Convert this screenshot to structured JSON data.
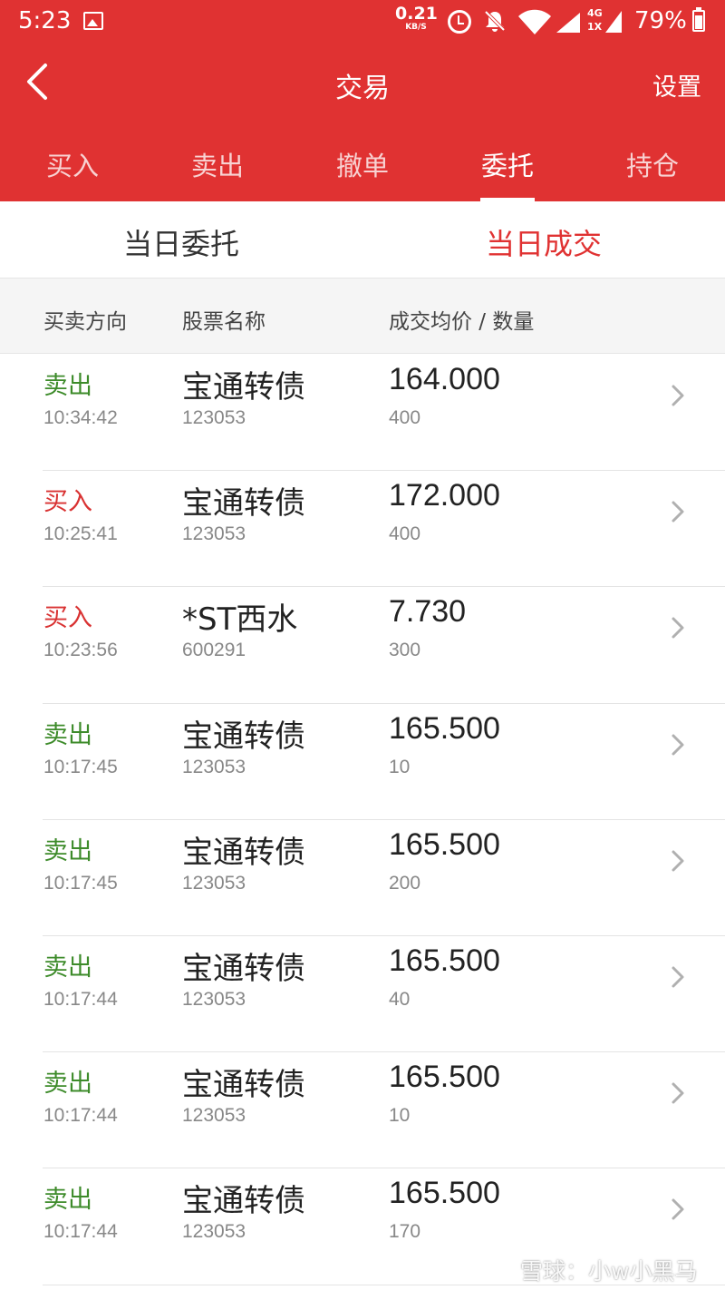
{
  "status_bar": {
    "time": "5:23",
    "net_speed": "0.21",
    "net_speed_unit": "KB/S",
    "network_badge_top": "4G",
    "network_badge_bottom": "1X",
    "battery": "79%"
  },
  "header": {
    "title": "交易",
    "settings_label": "设置"
  },
  "tabs": [
    {
      "label": "买入",
      "active": false
    },
    {
      "label": "卖出",
      "active": false
    },
    {
      "label": "撤单",
      "active": false
    },
    {
      "label": "委托",
      "active": true
    },
    {
      "label": "持仓",
      "active": false
    }
  ],
  "subtabs": [
    {
      "label": "当日委托",
      "active": false
    },
    {
      "label": "当日成交",
      "active": true
    }
  ],
  "columns": {
    "direction": "买卖方向",
    "stock_name": "股票名称",
    "price_qty": "成交均价 / 数量"
  },
  "rows": [
    {
      "direction": "卖出",
      "type": "sell",
      "time": "10:34:42",
      "name": "宝通转债",
      "code": "123053",
      "price": "164.000",
      "qty": "400"
    },
    {
      "direction": "买入",
      "type": "buy",
      "time": "10:25:41",
      "name": "宝通转债",
      "code": "123053",
      "price": "172.000",
      "qty": "400"
    },
    {
      "direction": "买入",
      "type": "buy",
      "time": "10:23:56",
      "name": "*ST西水",
      "code": "600291",
      "price": "7.730",
      "qty": "300"
    },
    {
      "direction": "卖出",
      "type": "sell",
      "time": "10:17:45",
      "name": "宝通转债",
      "code": "123053",
      "price": "165.500",
      "qty": "10"
    },
    {
      "direction": "卖出",
      "type": "sell",
      "time": "10:17:45",
      "name": "宝通转债",
      "code": "123053",
      "price": "165.500",
      "qty": "200"
    },
    {
      "direction": "卖出",
      "type": "sell",
      "time": "10:17:44",
      "name": "宝通转债",
      "code": "123053",
      "price": "165.500",
      "qty": "40"
    },
    {
      "direction": "卖出",
      "type": "sell",
      "time": "10:17:44",
      "name": "宝通转债",
      "code": "123053",
      "price": "165.500",
      "qty": "10"
    },
    {
      "direction": "卖出",
      "type": "sell",
      "time": "10:17:44",
      "name": "宝通转债",
      "code": "123053",
      "price": "165.500",
      "qty": "170"
    }
  ],
  "colors": {
    "brand_red": "#e03232",
    "buy": "#d93232",
    "sell": "#3d8b2a"
  },
  "icons": {
    "back": "chevron-left-icon",
    "row_arrow": "chevron-right-icon"
  },
  "watermark": "雪球：小w小黑马"
}
